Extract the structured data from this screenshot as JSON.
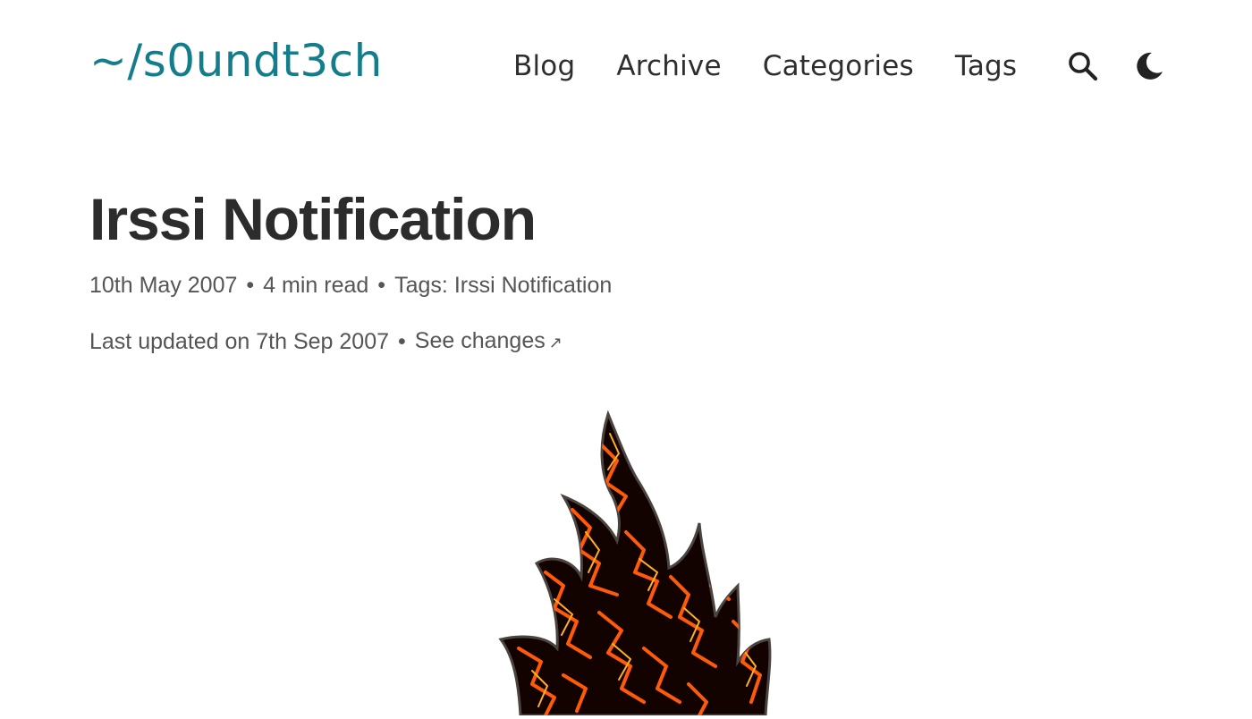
{
  "header": {
    "site_title": "~/s0undt3ch",
    "nav": [
      {
        "label": "Blog"
      },
      {
        "label": "Archive"
      },
      {
        "label": "Categories"
      },
      {
        "label": "Tags"
      }
    ],
    "search_icon": "search-icon",
    "theme_icon": "moon-icon"
  },
  "post": {
    "title": "Irssi Notification",
    "date": "10th May 2007",
    "read_time": "4 min read",
    "tags_label": "Tags:",
    "tag": "Irssi Notification",
    "updated": "Last updated on 7th Sep 2007",
    "see_changes": "See changes",
    "see_changes_icon": "external-arrow-icon"
  },
  "hero": {
    "icon": "flame-icon",
    "colors": {
      "fill": "#120200",
      "veins": "#ff5a0a",
      "glow": "#ffb020"
    }
  },
  "colors": {
    "accent": "#137d8c",
    "text": "#2e2e2e",
    "muted": "#555555",
    "background": "#ffffff"
  }
}
